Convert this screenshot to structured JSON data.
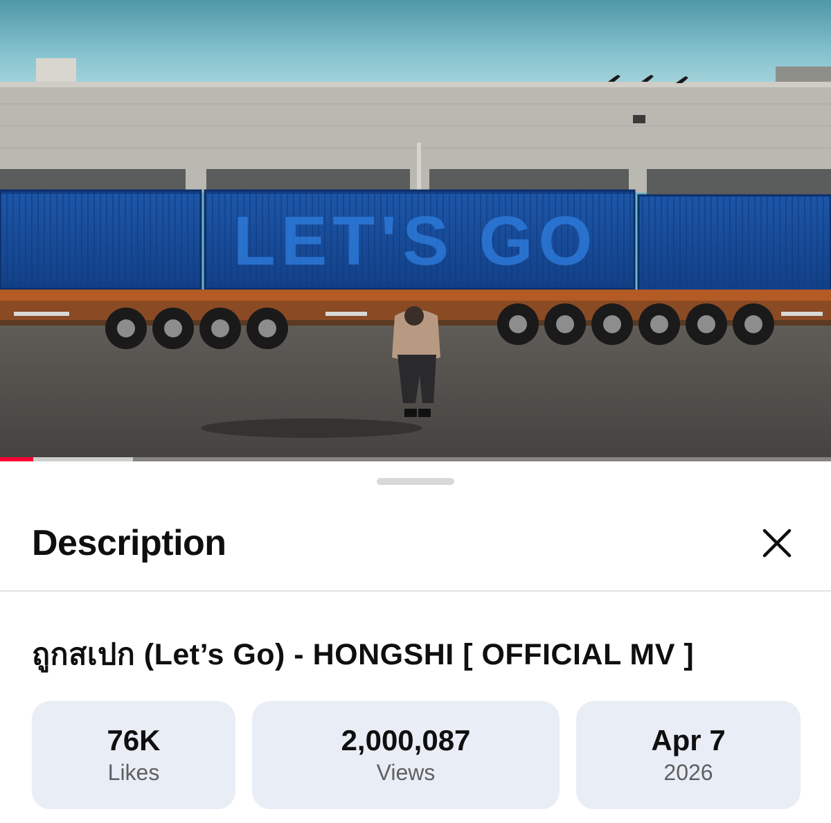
{
  "video": {
    "overlay_text": "LET'S GO",
    "progress_percent": 4,
    "buffered_percent": 16,
    "accent_color": "#ff0033"
  },
  "sheet": {
    "title": "Description",
    "close_icon": "close-icon"
  },
  "video_title": "ถูกสเปก (Let’s Go) - HONGSHI [ OFFICIAL MV ]",
  "stats": {
    "likes": {
      "value": "76K",
      "label": "Likes"
    },
    "views": {
      "value": "2,000,087",
      "label": "Views"
    },
    "date": {
      "value": "Apr 7",
      "label": "2026"
    }
  }
}
